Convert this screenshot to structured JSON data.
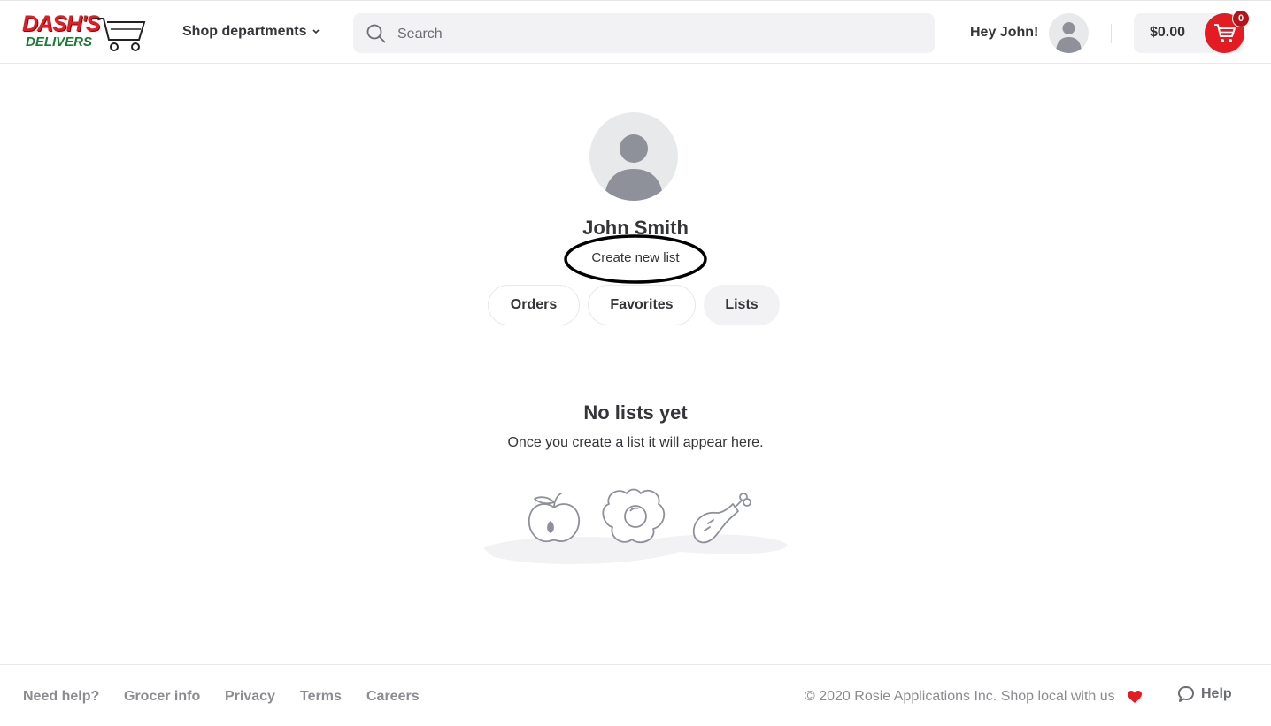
{
  "header": {
    "logo_line1": "DASH'S",
    "logo_line2": "DELIVERS",
    "shop_departments": "Shop departments",
    "search_placeholder": "Search",
    "greeting": "Hey John!",
    "cart_total": "$0.00",
    "cart_count": "0"
  },
  "profile": {
    "name": "John Smith",
    "create_list": "Create new list"
  },
  "tabs": [
    {
      "label": "Orders",
      "active": false
    },
    {
      "label": "Favorites",
      "active": false
    },
    {
      "label": "Lists",
      "active": true
    }
  ],
  "empty_state": {
    "title": "No lists yet",
    "subtitle": "Once you create a list it will appear here."
  },
  "footer": {
    "links": [
      "Need help?",
      "Grocer info",
      "Privacy",
      "Terms",
      "Careers"
    ],
    "copyright": "© 2020 Rosie Applications Inc. Shop local with us",
    "help": "Help"
  },
  "colors": {
    "brand_red": "#e31b23",
    "brand_green": "#1c7a33",
    "text": "#343538",
    "muted": "#8a8c90"
  },
  "icons": [
    "search-icon",
    "chevron-down-icon",
    "user-avatar-icon",
    "cart-icon",
    "apple-icon",
    "egg-icon",
    "drumstick-icon",
    "heart-icon",
    "chat-bubble-icon"
  ]
}
